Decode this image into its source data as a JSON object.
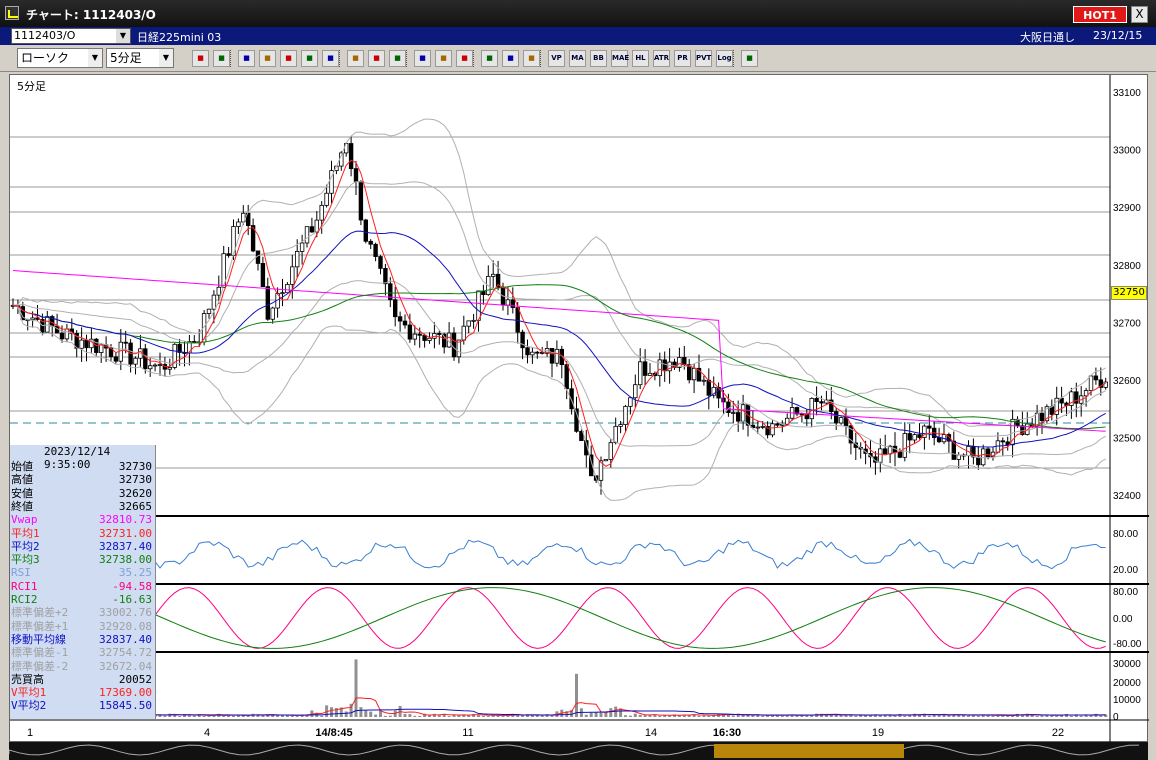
{
  "window": {
    "title": "チャート: 1112403/O",
    "hot_label": "HOT1",
    "close_label": "X"
  },
  "infobar": {
    "symbol": "1112403/O",
    "instrument": "日経225mini 03",
    "session": "大阪日通し",
    "date": "23/12/15"
  },
  "toolbar": {
    "chart_type": "ローソク",
    "interval": "5分足",
    "buttons": [
      "zoom-icon",
      "crosshair-icon",
      "trend-icon",
      "fib-icon",
      "box-icon",
      "ruler-icon",
      "lock-icon",
      "candle-up-icon",
      "candle-down-icon",
      "all-icon",
      "pen-icon",
      "cursor-icon",
      "undo-icon",
      "settings-icon",
      "brush-icon",
      "color-icon",
      "vp",
      "ma",
      "bb",
      "mae",
      "hl",
      "atr",
      "pr",
      "pvt",
      "log",
      "export-icon"
    ],
    "labels": {
      "vp": "VP",
      "ma": "MA",
      "bb": "BB",
      "mae": "MAE",
      "hl": "HL",
      "atr": "ATR",
      "pr": "PR",
      "pvt": "PVT",
      "log": "Log"
    }
  },
  "chart": {
    "period_label": "5分足",
    "current_price_label": "32750",
    "price_ticks": [
      "33100",
      "33000",
      "32900",
      "32800",
      "32700",
      "32600",
      "32500",
      "32400"
    ],
    "rsi_ticks": [
      "80.00",
      "20.00"
    ],
    "rci_ticks": [
      "80.00",
      "0.00",
      "-80.00"
    ],
    "vol_ticks": [
      "30000",
      "20000",
      "10000",
      "0"
    ],
    "x_ticks": [
      "1",
      "4",
      "14/8:45",
      "11",
      "14",
      "16:30",
      "19",
      "22"
    ],
    "colors": {
      "vwap": "#ff00ff",
      "ma1": "#ff2020",
      "ma2": "#1010c0",
      "ma3": "#108010",
      "bb": "#b0b0b0",
      "rsi": "#3a7fd0",
      "rci1": "#ff0080",
      "rci2": "#108010",
      "vol": "#909090"
    }
  },
  "info": {
    "datetime": "2023/12/14 9:35:00",
    "rows": [
      {
        "label": "始値",
        "value": "32730",
        "color": "#000"
      },
      {
        "label": "高値",
        "value": "32730",
        "color": "#000"
      },
      {
        "label": "安値",
        "value": "32620",
        "color": "#000"
      },
      {
        "label": "終値",
        "value": "32665",
        "color": "#000"
      },
      {
        "label": "Vwap",
        "value": "32810.73",
        "color": "#ff00ff"
      },
      {
        "label": "平均1",
        "value": "32731.00",
        "color": "#ff2020"
      },
      {
        "label": "平均2",
        "value": "32837.40",
        "color": "#1010c0"
      },
      {
        "label": "平均3",
        "value": "32738.00",
        "color": "#108010"
      },
      {
        "label": "RSI",
        "value": "35.25",
        "color": "#80a0d8"
      },
      {
        "label": "RCI1",
        "value": "-94.58",
        "color": "#ff0080"
      },
      {
        "label": "RCI2",
        "value": "-16.63",
        "color": "#108010"
      },
      {
        "label": "標準偏差+2",
        "value": "33002.76",
        "color": "#a0a0a0"
      },
      {
        "label": "標準偏差+1",
        "value": "32920.08",
        "color": "#a0a0a0"
      },
      {
        "label": "移動平均線",
        "value": "32837.40",
        "color": "#1010c0"
      },
      {
        "label": "標準偏差-1",
        "value": "32754.72",
        "color": "#a0a0a0"
      },
      {
        "label": "標準偏差-2",
        "value": "32672.04",
        "color": "#a0a0a0"
      },
      {
        "label": "売買高",
        "value": "20052",
        "color": "#000"
      },
      {
        "label": "V平均1",
        "value": "17369.00",
        "color": "#ff2020"
      },
      {
        "label": "V平均2",
        "value": "15845.50",
        "color": "#1010c0"
      }
    ]
  }
}
